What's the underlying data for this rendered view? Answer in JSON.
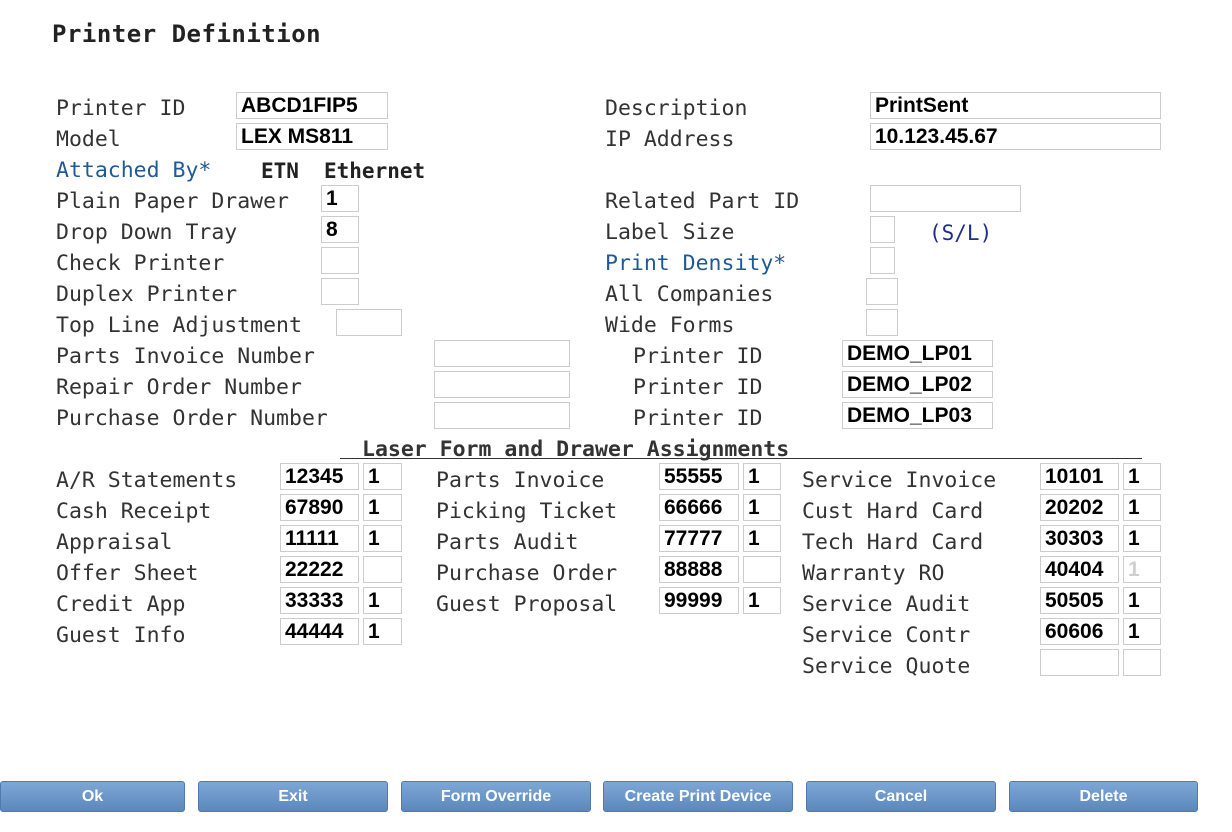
{
  "title": "Printer Definition",
  "fields": {
    "printer_id": {
      "label": "Printer ID",
      "value": "ABCD1FIP5"
    },
    "model": {
      "label": "Model",
      "value": "LEX MS811"
    },
    "attached_by": {
      "label": "Attached By*",
      "code": "ETN",
      "text": "Ethernet"
    },
    "plain_paper_drawer": {
      "label": "Plain Paper Drawer",
      "value": "1"
    },
    "drop_down_tray": {
      "label": "Drop Down Tray",
      "value": "8"
    },
    "check_printer": {
      "label": "Check Printer",
      "value": ""
    },
    "duplex_printer": {
      "label": "Duplex Printer",
      "value": ""
    },
    "top_line_adjustment": {
      "label": "Top Line Adjustment",
      "value": ""
    },
    "parts_invoice_number": {
      "label": "Parts Invoice Number",
      "value": ""
    },
    "repair_order_number": {
      "label": "Repair Order Number",
      "value": ""
    },
    "purchase_order_number": {
      "label": "Purchase Order Number",
      "value": ""
    },
    "description": {
      "label": "Description",
      "value": "PrintSent"
    },
    "ip_address": {
      "label": "IP Address",
      "value": "10.123.45.67"
    },
    "related_part_id": {
      "label": "Related Part ID",
      "value": ""
    },
    "label_size": {
      "label": "Label Size",
      "value": "",
      "hint": "(S/L)"
    },
    "print_density": {
      "label": "Print Density*",
      "value": ""
    },
    "all_companies": {
      "label": "All Companies",
      "value": ""
    },
    "wide_forms": {
      "label": "Wide Forms",
      "value": ""
    },
    "printer_id_1": {
      "label": "Printer ID",
      "value": "DEMO_LP01"
    },
    "printer_id_2": {
      "label": "Printer ID",
      "value": "DEMO_LP02"
    },
    "printer_id_3": {
      "label": "Printer ID",
      "value": "DEMO_LP03"
    }
  },
  "assignments": {
    "section_title": "Laser Form and Drawer Assignments",
    "col1": [
      {
        "label": "A/R Statements",
        "form": "12345",
        "drawer": "1"
      },
      {
        "label": "Cash Receipt",
        "form": "67890",
        "drawer": "1"
      },
      {
        "label": "Appraisal",
        "form": "11111",
        "drawer": "1"
      },
      {
        "label": "Offer Sheet",
        "form": "22222",
        "drawer": ""
      },
      {
        "label": "Credit App",
        "form": "33333",
        "drawer": "1"
      },
      {
        "label": "Guest Info",
        "form": "44444",
        "drawer": "1"
      }
    ],
    "col2": [
      {
        "label": "Parts Invoice",
        "form": "55555",
        "drawer": "1"
      },
      {
        "label": "Picking Ticket",
        "form": "66666",
        "drawer": "1"
      },
      {
        "label": "Parts Audit",
        "form": "77777",
        "drawer": "1"
      },
      {
        "label": "Purchase Order",
        "form": "88888",
        "drawer": ""
      },
      {
        "label": "Guest Proposal",
        "form": "99999",
        "drawer": "1"
      }
    ],
    "col3": [
      {
        "label": "Service Invoice",
        "form": "10101",
        "drawer": "1"
      },
      {
        "label": "Cust Hard Card",
        "form": "20202",
        "drawer": "1"
      },
      {
        "label": "Tech Hard Card",
        "form": "30303",
        "drawer": "1"
      },
      {
        "label": "Warranty RO",
        "form": "40404",
        "drawer": "1"
      },
      {
        "label": "Service Audit",
        "form": "50505",
        "drawer": "1"
      },
      {
        "label": "Service Contr",
        "form": "60606",
        "drawer": "1"
      },
      {
        "label": "Service Quote",
        "form": "",
        "drawer": ""
      }
    ]
  },
  "buttons": {
    "ok": "Ok",
    "exit": "Exit",
    "form_override": "Form Override",
    "create_print_device": "Create Print Device",
    "cancel": "Cancel",
    "delete": "Delete"
  },
  "colors": {
    "link_label": "#1f5a96",
    "hint": "#1a2f8a",
    "button": "#6a95c8"
  }
}
